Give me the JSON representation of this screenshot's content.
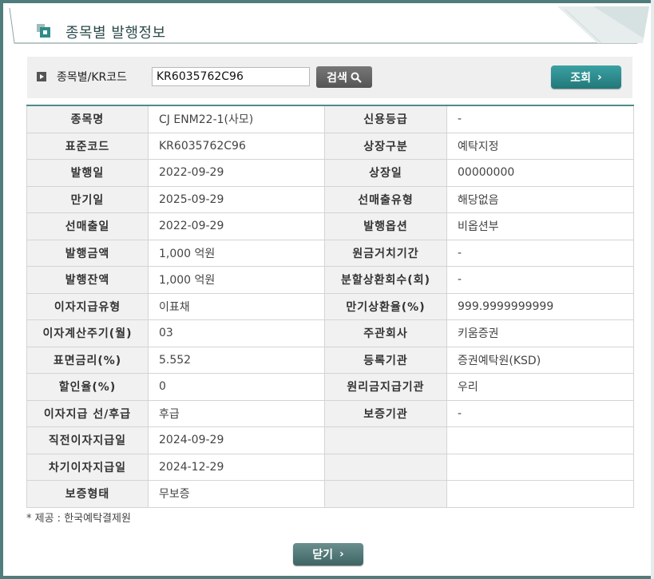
{
  "header": {
    "title": "종목별 발행정보"
  },
  "search": {
    "label": "종목별/KR코드",
    "input_value": "KR6035762C96",
    "search_button": "검색",
    "query_button": "조회"
  },
  "table": {
    "rows": [
      {
        "l1": "종목명",
        "v1": "CJ ENM22-1(사모)",
        "l2": "신용등급",
        "v2": "-"
      },
      {
        "l1": "표준코드",
        "v1": "KR6035762C96",
        "l2": "상장구분",
        "v2": "예탁지정"
      },
      {
        "l1": "발행일",
        "v1": "2022-09-29",
        "l2": "상장일",
        "v2": "00000000"
      },
      {
        "l1": "만기일",
        "v1": "2025-09-29",
        "l2": "선매출유형",
        "v2": "해당없음"
      },
      {
        "l1": "선매출일",
        "v1": "2022-09-29",
        "l2": "발행옵션",
        "v2": "비옵션부"
      },
      {
        "l1": "발행금액",
        "v1": "1,000 억원",
        "l2": "원금거치기간",
        "v2": "-"
      },
      {
        "l1": "발행잔액",
        "v1": "1,000 억원",
        "l2": "분할상환회수(회)",
        "v2": "-"
      },
      {
        "l1": "이자지급유형",
        "v1": "이표채",
        "l2": "만기상환율(%)",
        "v2": "999.9999999999"
      },
      {
        "l1": "이자계산주기(월)",
        "v1": "03",
        "l2": "주관회사",
        "v2": "키움증권"
      },
      {
        "l1": "표면금리(%)",
        "v1": "5.552",
        "l2": "등록기관",
        "v2": "증권예탁원(KSD)"
      },
      {
        "l1": "할인율(%)",
        "v1": "0",
        "l2": "원리금지급기관",
        "v2": "우리"
      },
      {
        "l1": "이자지급 선/후급",
        "v1": "후급",
        "l2": "보증기관",
        "v2": "-"
      },
      {
        "l1": "직전이자지급일",
        "v1": "2024-09-29",
        "l2": "",
        "v2": ""
      },
      {
        "l1": "차기이자지급일",
        "v1": "2024-12-29",
        "l2": "",
        "v2": ""
      },
      {
        "l1": "보증형태",
        "v1": "무보증",
        "l2": "",
        "v2": ""
      }
    ]
  },
  "footnote": "* 제공 : 한국예탁결제원",
  "close_button": "닫기",
  "colors": {
    "accent": "#4f7d7b",
    "query_button": "#2a8a8c",
    "label_bg": "#f1f1f1"
  }
}
